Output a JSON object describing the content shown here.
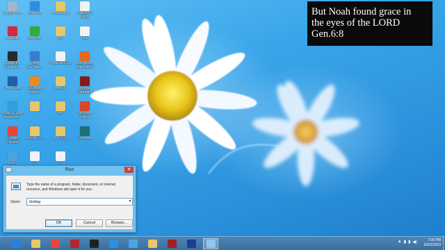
{
  "desktop": {
    "icons": [
      {
        "label": "Recycle Bin",
        "icon": "recycle-bin-icon",
        "color": "#9fb7c9"
      },
      {
        "label": "SHAREit",
        "icon": "shareit-icon",
        "color": "#2f8ee0"
      },
      {
        "label": "new videos",
        "icon": "folder-icon",
        "color": "#e8c76a"
      },
      {
        "label": "DADDY'S\nWEB",
        "icon": "document-icon",
        "color": "#f2f2f2"
      },
      {
        "label": "Audacity",
        "icon": "audacity-icon",
        "color": "#d8283a"
      },
      {
        "label": "SMADAV",
        "icon": "smadav-icon",
        "color": "#2fae3c"
      },
      {
        "label": "rm",
        "icon": "folder-icon",
        "color": "#e8c76a"
      },
      {
        "label": "OLE",
        "icon": "document-icon",
        "color": "#f2f2f2"
      },
      {
        "label": "CyberLink\nScreenR...",
        "icon": "cyberlink-icon",
        "color": "#2a2a2a"
      },
      {
        "label": "Orbit\nYouTube...",
        "icon": "orbit-icon",
        "color": "#3a7ad0"
      },
      {
        "label": "OMEGA 2018",
        "icon": "document-icon",
        "color": "#f2f2f2"
      },
      {
        "label": "Microsoft\nOffice 2007",
        "icon": "office-icon",
        "color": "#e36a1f"
      },
      {
        "label": "Driver Easy",
        "icon": "drivereasy-icon",
        "color": "#1f5fa8"
      },
      {
        "label": "VLC media\nplayer",
        "icon": "vlc-icon",
        "color": "#f08a1c"
      },
      {
        "label": "other v",
        "icon": "folder-icon",
        "color": "#e8c76a"
      },
      {
        "label": "Mortal\nKombat 4",
        "icon": "mortal-kombat-icon",
        "color": "#8a1a1a"
      },
      {
        "label": "EaseUS Data\nRecovery...",
        "icon": "easeus-icon",
        "color": "#2fa0d8"
      },
      {
        "label": "...",
        "icon": "folder-icon",
        "color": "#e8c76a"
      },
      {
        "label": "pro",
        "icon": "folder-icon",
        "color": "#e8c76a"
      },
      {
        "label": "Microsoft\nOffice",
        "icon": "office-icon",
        "color": "#d9472b"
      },
      {
        "label": "Google\nChrome",
        "icon": "chrome-icon",
        "color": "#e8453c"
      },
      {
        "label": "ADOBE 2...",
        "icon": "folder-icon",
        "color": "#e8c76a"
      },
      {
        "label": "pro 2018",
        "icon": "folder-icon",
        "color": "#e8c76a"
      },
      {
        "label": "Geometr",
        "icon": "geometry-icon",
        "color": "#1f6f78"
      },
      {
        "label": "Wyn...",
        "icon": "app-icon",
        "color": "#4da3e0"
      },
      {
        "label": "T...",
        "icon": "document-icon",
        "color": "#f2f2f2"
      },
      {
        "label": "...",
        "icon": "document-icon",
        "color": "#f2f2f2"
      }
    ]
  },
  "verse": {
    "lines": [
      "But Noah found grace in",
      "the eyes of the LORD",
      "Gen.6:8"
    ]
  },
  "run_dialog": {
    "title": "Run",
    "close_glyph": "✕",
    "description": "Type the name of a program, folder, document, or Internet resource, and Windows will open it for you.",
    "open_label": "Open:",
    "open_value": "dxdiag",
    "ok_label": "OK",
    "cancel_label": "Cancel",
    "browse_label": "Browse..."
  },
  "taskbar": {
    "items": [
      {
        "icon": "ie-icon",
        "color": "#2b7fd6"
      },
      {
        "icon": "explorer-icon",
        "color": "#e8c76a"
      },
      {
        "icon": "chrome-icon",
        "color": "#e8453c"
      },
      {
        "icon": "media-icon",
        "color": "#b2272d"
      },
      {
        "icon": "cyberlink-icon",
        "color": "#222222"
      },
      {
        "icon": "shareit-icon",
        "color": "#2f8ee0"
      },
      {
        "icon": "app-icon",
        "color": "#4da3e0"
      },
      {
        "icon": "folder-icon",
        "color": "#e8c76a"
      },
      {
        "icon": "game-icon",
        "color": "#a02020"
      },
      {
        "icon": "pes-icon",
        "color": "#1a3f8c"
      },
      {
        "icon": "run-icon",
        "color": "#8fc6f0",
        "active": true
      }
    ],
    "tray_glyphs": [
      "▲",
      "▮",
      "▮",
      "◀)"
    ],
    "clock_time": "7:30 PM",
    "clock_date": "10/22/2019"
  }
}
